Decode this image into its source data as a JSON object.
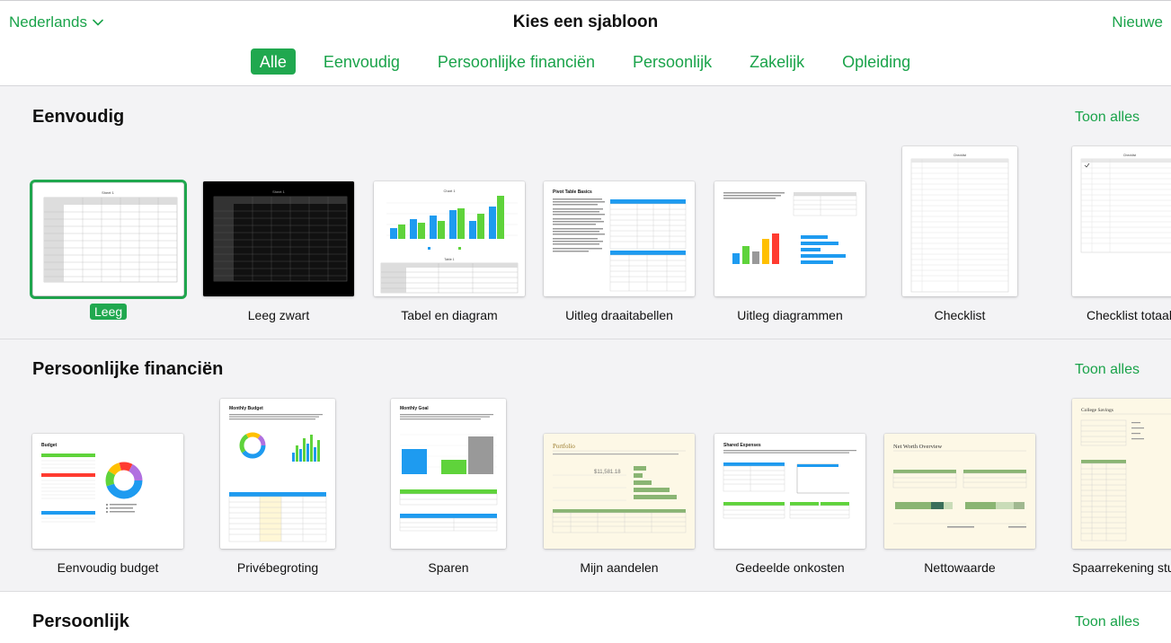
{
  "header": {
    "language": "Nederlands",
    "title": "Kies een sjabloon",
    "new_label": "Nieuwe"
  },
  "tabs": [
    {
      "label": "Alle",
      "active": true
    },
    {
      "label": "Eenvoudig",
      "active": false
    },
    {
      "label": "Persoonlijke financiën",
      "active": false
    },
    {
      "label": "Persoonlijk",
      "active": false
    },
    {
      "label": "Zakelijk",
      "active": false
    },
    {
      "label": "Opleiding",
      "active": false
    }
  ],
  "sections": [
    {
      "title": "Eenvoudig",
      "show_all": "Toon alles",
      "templates": [
        {
          "label": "Leeg",
          "selected": true
        },
        {
          "label": "Leeg zwart"
        },
        {
          "label": "Tabel en diagram"
        },
        {
          "label": "Uitleg draaitabellen"
        },
        {
          "label": "Uitleg diagrammen"
        },
        {
          "label": "Checklist"
        },
        {
          "label": "Checklist totaal"
        }
      ]
    },
    {
      "title": "Persoonlijke financiën",
      "show_all": "Toon alles",
      "templates": [
        {
          "label": "Eenvoudig budget"
        },
        {
          "label": "Privébegroting"
        },
        {
          "label": "Sparen"
        },
        {
          "label": "Mijn aandelen"
        },
        {
          "label": "Gedeelde onkosten"
        },
        {
          "label": "Nettowaarde"
        },
        {
          "label": "Spaarrekening studie"
        }
      ]
    },
    {
      "title": "Persoonlijk",
      "show_all": "Toon alles"
    }
  ],
  "thumb_text": {
    "budget": "Budget",
    "monthly_budget": "Monthly Budget",
    "monthly_goal": "Monthly Goal",
    "portfolio": "Portfolio",
    "shared_expenses": "Shared Expenses",
    "net_worth": "Net Worth Overview",
    "college_savings": "College Savings",
    "pivot_basics": "Pivot Table Basics"
  },
  "colors": {
    "accent": "#1aa34a",
    "accent_fill": "#20a84f",
    "bar_blue": "#1e9bf0",
    "bar_green": "#5fd33b"
  }
}
